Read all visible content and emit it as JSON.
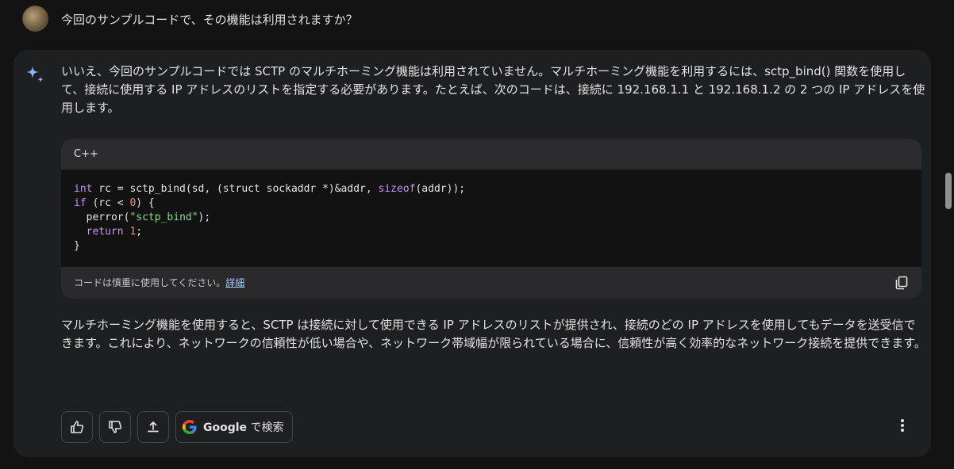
{
  "user_prompt": {
    "text": "今回のサンプルコードで、その機能は利用されますか？"
  },
  "response": {
    "paragraph1": "いいえ、今回のサンプルコードでは SCTP のマルチホーミング機能は利用されていません。マルチホーミング機能を利用するには、sctp_bind() 関数を使用して、接続に使用する IP アドレスのリストを指定する必要があります。たとえば、次のコードは、接続に 192.168.1.1 と 192.168.1.2 の 2 つの IP アドレスを使用します。",
    "code": {
      "language": "C++",
      "lines": [
        "int rc = sctp_bind(sd, (struct sockaddr *)&addr, sizeof(addr));",
        "if (rc < 0) {",
        "  perror(\"sctp_bind\");",
        "  return 1;",
        "}"
      ],
      "footer_note": "コードは慎重に使用してください。",
      "footer_link": "詳細"
    },
    "paragraph2": "マルチホーミング機能を使用すると、SCTP は接続に対して使用できる IP アドレスのリストが提供され、接続のどの IP アドレスを使用してもデータを送受信できます。これにより、ネットワークの信頼性が低い場合や、ネットワーク帯域幅が限られている場合に、信頼性が高く効率的なネットワーク接続を提供できます。"
  },
  "actions": {
    "google_label": "Google",
    "search_suffix": "で検索"
  },
  "colors": {
    "background": "#131314",
    "card": "#1e1f20",
    "keyword": "#c792ea",
    "string": "#86d886",
    "number": "#f78c6c",
    "link": "#a8c7fa"
  }
}
